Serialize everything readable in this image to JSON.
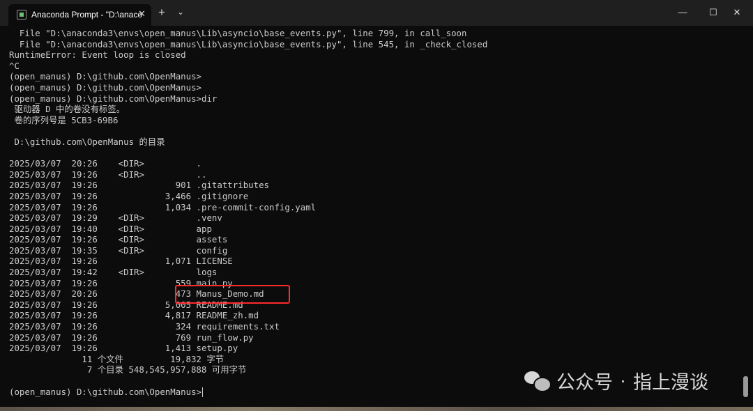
{
  "window": {
    "tab_title": "Anaconda Prompt - \"D:\\anaco",
    "tab_close": "✕",
    "new_tab": "+",
    "dropdown": "⌄",
    "minimize": "—",
    "maximize": "☐",
    "close": "✕"
  },
  "terminal": {
    "lines": [
      "  File \"D:\\anaconda3\\envs\\open_manus\\Lib\\asyncio\\base_events.py\", line 799, in call_soon",
      "  File \"D:\\anaconda3\\envs\\open_manus\\Lib\\asyncio\\base_events.py\", line 545, in _check_closed",
      "RuntimeError: Event loop is closed",
      "^C",
      "(open_manus) D:\\github.com\\OpenManus>",
      "(open_manus) D:\\github.com\\OpenManus>",
      "(open_manus) D:\\github.com\\OpenManus>dir",
      " 驱动器 D 中的卷没有标签。",
      " 卷的序列号是 5CB3-69B6",
      "",
      " D:\\github.com\\OpenManus 的目录",
      "",
      "2025/03/07  20:26    <DIR>          .",
      "2025/03/07  19:26    <DIR>          ..",
      "2025/03/07  19:26               901 .gitattributes",
      "2025/03/07  19:26             3,466 .gitignore",
      "2025/03/07  19:26             1,034 .pre-commit-config.yaml",
      "2025/03/07  19:29    <DIR>          .venv",
      "2025/03/07  19:40    <DIR>          app",
      "2025/03/07  19:26    <DIR>          assets",
      "2025/03/07  19:35    <DIR>          config",
      "2025/03/07  19:26             1,071 LICENSE",
      "2025/03/07  19:42    <DIR>          logs",
      "2025/03/07  19:26               559 main.py",
      "2025/03/07  20:26               473 Manus_Demo.md",
      "2025/03/07  19:26             5,005 README.md",
      "2025/03/07  19:26             4,817 README_zh.md",
      "2025/03/07  19:26               324 requirements.txt",
      "2025/03/07  19:26               769 run_flow.py",
      "2025/03/07  19:26             1,413 setup.py",
      "              11 个文件         19,832 字节",
      "               7 个目录 548,545,957,888 可用字节",
      ""
    ],
    "prompt": "(open_manus) D:\\github.com\\OpenManus>"
  },
  "watermark": {
    "text1": "公众号",
    "dot": "·",
    "text2": "指上漫谈"
  },
  "colors": {
    "terminal_bg": "#0c0c0c",
    "terminal_text": "#cccccc",
    "highlight": "#ff2a2a"
  }
}
